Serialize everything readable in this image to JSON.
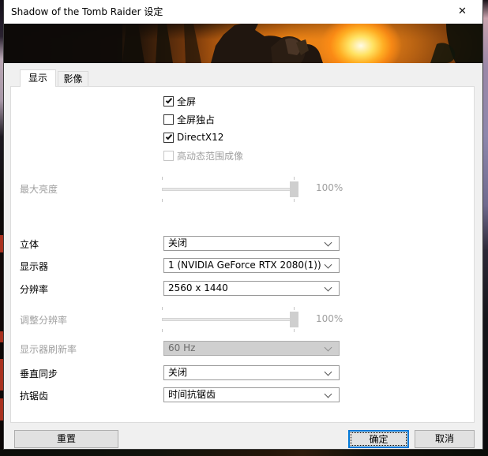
{
  "window": {
    "title": "Shadow of the Tomb Raider 设定",
    "close_icon": "✕"
  },
  "tabs": [
    {
      "label": "显示",
      "active": true
    },
    {
      "label": "影像",
      "active": false
    }
  ],
  "checkboxes": [
    {
      "label": "全屏",
      "checked": true,
      "enabled": true
    },
    {
      "label": "全屏独占",
      "checked": false,
      "enabled": true
    },
    {
      "label": "DirectX12",
      "checked": true,
      "enabled": true
    },
    {
      "label": "高动态范围成像",
      "checked": false,
      "enabled": false
    }
  ],
  "sliders": [
    {
      "label": "最大亮度",
      "value": "100%",
      "enabled": false,
      "position": "max"
    },
    {
      "label": "调整分辨率",
      "value": "100%",
      "enabled": false,
      "position": "max"
    }
  ],
  "dropdowns": [
    {
      "label": "立体",
      "value": "关闭",
      "enabled": true
    },
    {
      "label": "显示器",
      "value": "1 (NVIDIA GeForce RTX 2080(1))",
      "enabled": true
    },
    {
      "label": "分辨率",
      "value": "2560 x 1440",
      "enabled": true
    },
    {
      "label": "显示器刷新率",
      "value": "60 Hz",
      "enabled": false
    },
    {
      "label": "垂直同步",
      "value": "关闭",
      "enabled": true
    },
    {
      "label": "抗锯齿",
      "value": "时间抗锯齿",
      "enabled": true
    }
  ],
  "buttons": {
    "reset": "重置",
    "ok": "确定",
    "cancel": "取消"
  },
  "colors": {
    "accent_blue": "#0078d7",
    "dialog_bg": "#f0f0f0",
    "panel_bg": "#ffffff",
    "disabled_text": "#a0a0a0",
    "banner_orange": "#e88f16"
  }
}
